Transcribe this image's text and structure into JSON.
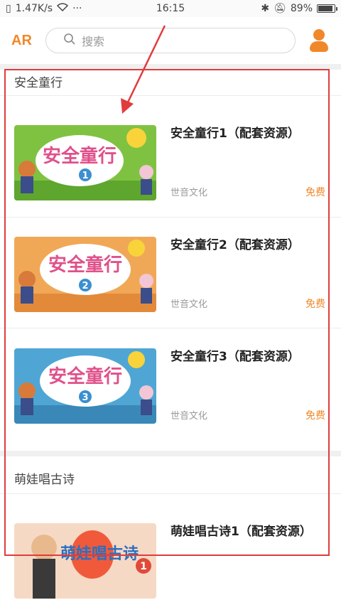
{
  "status_bar": {
    "network_speed": "1.47K/s",
    "dots": "···",
    "time": "16:15",
    "battery_percent": "89%",
    "battery_level": 0.89
  },
  "header": {
    "logo": "AR",
    "search_placeholder": "搜索"
  },
  "sections": [
    {
      "title": "安全童行",
      "items": [
        {
          "title": "安全童行1（配套资源）",
          "publisher": "世音文化",
          "price": "免费",
          "thumb_text": "安全童行",
          "thumb_num": "1"
        },
        {
          "title": "安全童行2（配套资源）",
          "publisher": "世音文化",
          "price": "免费",
          "thumb_text": "安全童行",
          "thumb_num": "2"
        },
        {
          "title": "安全童行3（配套资源）",
          "publisher": "世音文化",
          "price": "免费",
          "thumb_text": "安全童行",
          "thumb_num": "3"
        }
      ]
    },
    {
      "title": "萌娃唱古诗",
      "items": [
        {
          "title": "萌娃唱古诗1（配套资源）",
          "thumb_text": "萌娃唱古诗",
          "thumb_num": "1"
        }
      ]
    }
  ],
  "colors": {
    "accent": "#f0882a",
    "highlight_border": "#e03c3c"
  }
}
